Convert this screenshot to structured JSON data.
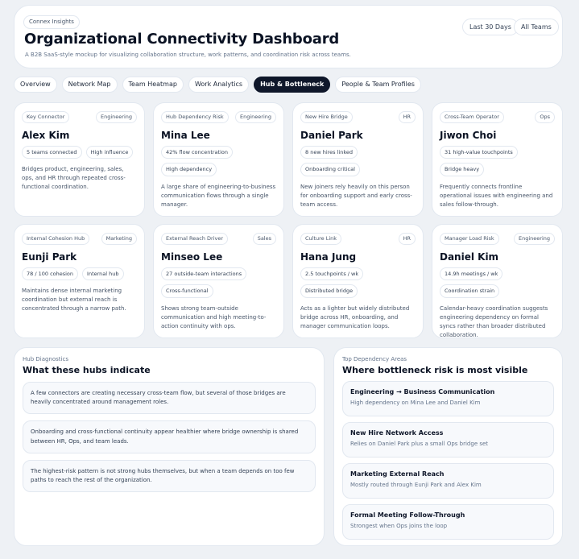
{
  "header": {
    "kicker": "Connex Insights",
    "title": "Organizational Connectivity Dashboard",
    "subtitle": "A B2B SaaS-style mockup for visualizing collaboration structure, work patterns, and coordination risk across teams.",
    "range_label": "Last 30 Days",
    "teams_label": "All Teams"
  },
  "tabs": [
    {
      "label": "Overview",
      "active": false
    },
    {
      "label": "Network Map",
      "active": false
    },
    {
      "label": "Team Heatmap",
      "active": false
    },
    {
      "label": "Work Analytics",
      "active": false
    },
    {
      "label": "Hub & Bottleneck",
      "active": true
    },
    {
      "label": "People & Team Profiles",
      "active": false
    }
  ],
  "cards": [
    {
      "role": "Key Connector",
      "dept": "Engineering",
      "name": "Alex Kim",
      "stats": [
        "5 teams connected",
        "High influence"
      ],
      "desc": "Bridges product, engineering, sales, ops, and HR through repeated cross-functional coordination."
    },
    {
      "role": "Hub Dependency Risk",
      "dept": "Engineering",
      "name": "Mina Lee",
      "stats": [
        "42% flow concentration",
        "High dependency"
      ],
      "desc": "A large share of engineering-to-business communication flows through a single manager."
    },
    {
      "role": "New Hire Bridge",
      "dept": "HR",
      "name": "Daniel Park",
      "stats": [
        "8 new hires linked",
        "Onboarding critical"
      ],
      "desc": "New joiners rely heavily on this person for onboarding support and early cross-team access."
    },
    {
      "role": "Cross-Team Operator",
      "dept": "Ops",
      "name": "Jiwon Choi",
      "stats": [
        "31 high-value touchpoints",
        "Bridge heavy"
      ],
      "desc": "Frequently connects frontline operational issues with engineering and sales follow-through."
    },
    {
      "role": "Internal Cohesion Hub",
      "dept": "Marketing",
      "name": "Eunji Park",
      "stats": [
        "78 / 100 cohesion",
        "Internal hub"
      ],
      "desc": "Maintains dense internal marketing coordination but external reach is concentrated through a narrow path."
    },
    {
      "role": "External Reach Driver",
      "dept": "Sales",
      "name": "Minseo Lee",
      "stats": [
        "27 outside-team interactions",
        "Cross-functional"
      ],
      "desc": "Shows strong team-outside communication and high meeting-to-action continuity with ops."
    },
    {
      "role": "Culture Link",
      "dept": "HR",
      "name": "Hana Jung",
      "stats": [
        "2.5 touchpoints / wk",
        "Distributed bridge"
      ],
      "desc": "Acts as a lighter but widely distributed bridge across HR, onboarding, and manager communication loops."
    },
    {
      "role": "Manager Load Risk",
      "dept": "Engineering",
      "name": "Daniel Kim",
      "stats": [
        "14.9h meetings / wk",
        "Coordination strain"
      ],
      "desc": "Calendar-heavy coordination suggests engineering dependency on formal syncs rather than broader distributed collaboration."
    }
  ],
  "diagnostics": {
    "kicker": "Hub Diagnostics",
    "title": "What these hubs indicate",
    "items": [
      "A few connectors are creating necessary cross-team flow, but several of those bridges are heavily concentrated around management roles.",
      "Onboarding and cross-functional continuity appear healthier where bridge ownership is shared between HR, Ops, and team leads.",
      "The highest-risk pattern is not strong hubs themselves, but when a team depends on too few paths to reach the rest of the organization."
    ]
  },
  "dependency": {
    "kicker": "Top Dependency Areas",
    "title": "Where bottleneck risk is most visible",
    "items": [
      {
        "title": "Engineering → Business Communication",
        "sub": "High dependency on Mina Lee and Daniel Kim"
      },
      {
        "title": "New Hire Network Access",
        "sub": "Relies on Daniel Park plus a small Ops bridge set"
      },
      {
        "title": "Marketing External Reach",
        "sub": "Mostly routed through Eunji Park and Alex Kim"
      },
      {
        "title": "Formal Meeting Follow-Through",
        "sub": "Strongest when Ops joins the loop"
      }
    ]
  }
}
